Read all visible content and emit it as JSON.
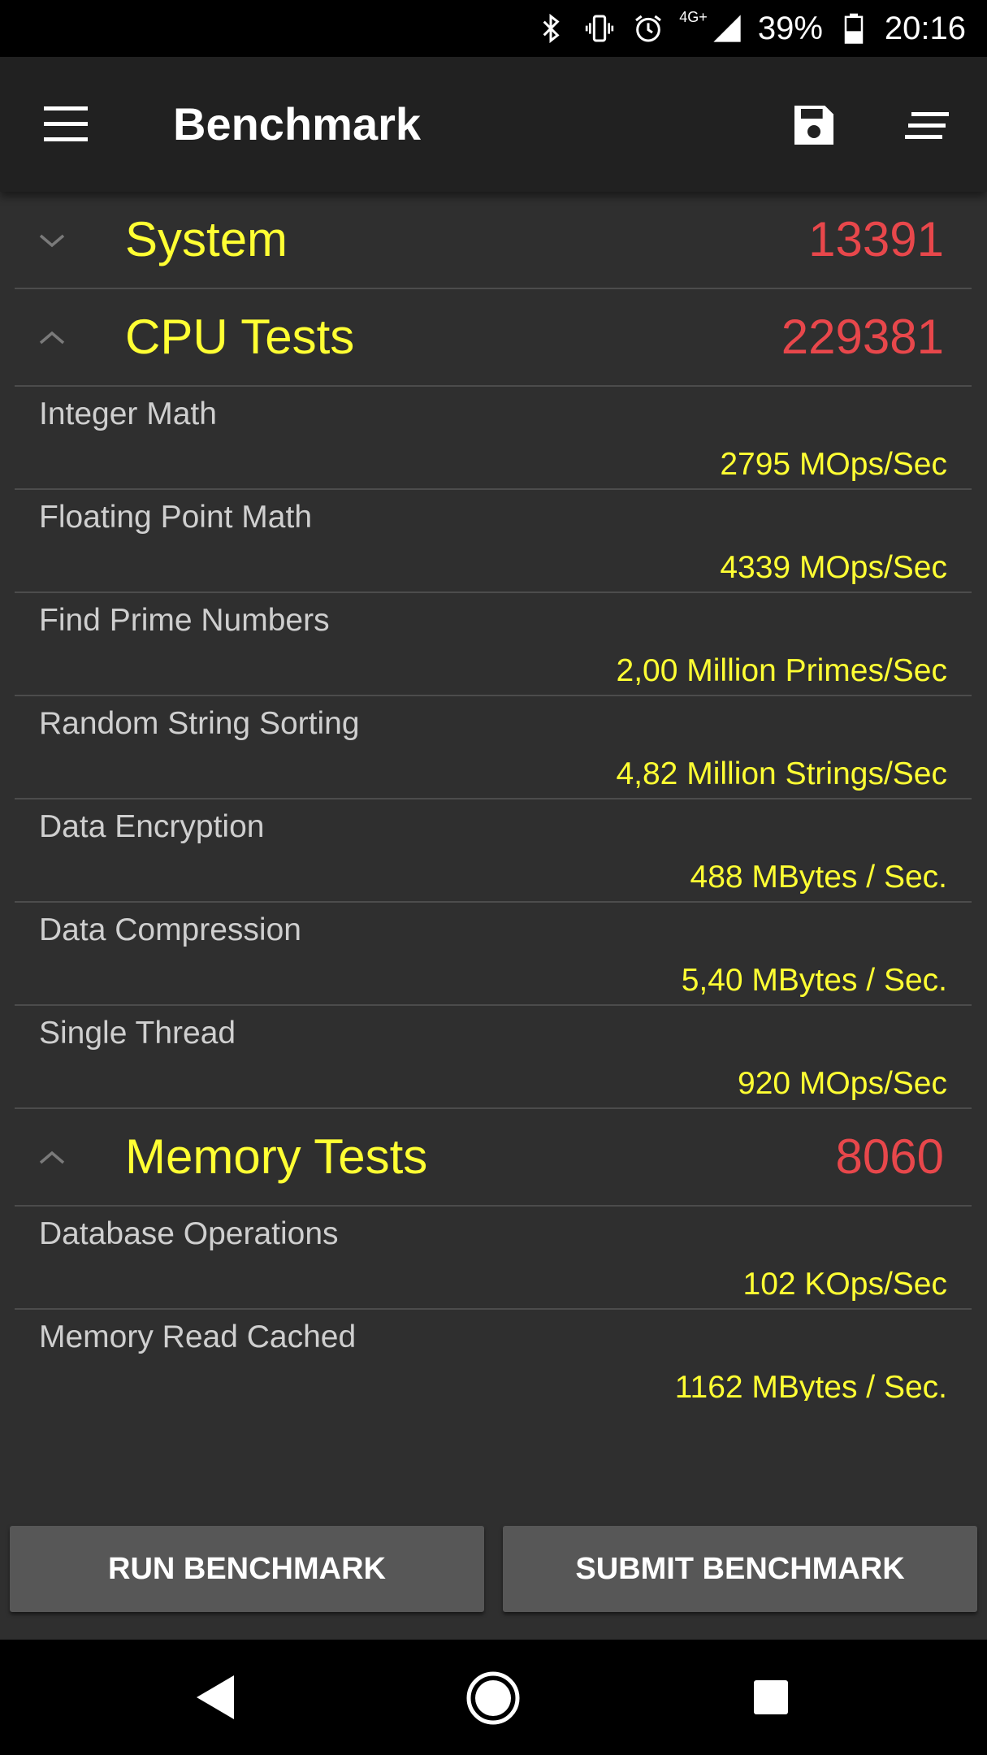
{
  "status_bar": {
    "network": "4G+",
    "battery": "39%",
    "time": "20:16",
    "icons": [
      "bluetooth-icon",
      "vibrate-icon",
      "alarm-icon",
      "signal-icon",
      "battery-icon"
    ]
  },
  "toolbar": {
    "title": "Benchmark",
    "icons": [
      "menu-icon",
      "save-icon",
      "sort-icon"
    ]
  },
  "sections": [
    {
      "name": "System",
      "score": "13391",
      "expanded": false
    },
    {
      "name": "CPU Tests",
      "score": "229381",
      "expanded": true
    },
    {
      "name": "Memory Tests",
      "score": "8060",
      "expanded": true
    }
  ],
  "cpu_tests": [
    {
      "name": "Integer Math",
      "value": "2795 MOps/Sec"
    },
    {
      "name": "Floating Point Math",
      "value": "4339 MOps/Sec"
    },
    {
      "name": "Find Prime Numbers",
      "value": "2,00 Million Primes/Sec"
    },
    {
      "name": "Random String Sorting",
      "value": "4,82 Million Strings/Sec"
    },
    {
      "name": "Data Encryption",
      "value": "488 MBytes / Sec."
    },
    {
      "name": "Data Compression",
      "value": "5,40 MBytes / Sec."
    },
    {
      "name": "Single Thread",
      "value": "920 MOps/Sec"
    }
  ],
  "memory_tests": [
    {
      "name": "Database Operations",
      "value": "102 KOps/Sec"
    },
    {
      "name": "Memory Read Cached",
      "value": "1162 MBytes / Sec."
    }
  ],
  "buttons": {
    "run": "RUN BENCHMARK",
    "submit": "SUBMIT BENCHMARK"
  },
  "colors": {
    "title_yellow": "#ffff33",
    "score_red": "#e8474b",
    "background": "#2f2f2f",
    "toolbar": "#212121"
  }
}
